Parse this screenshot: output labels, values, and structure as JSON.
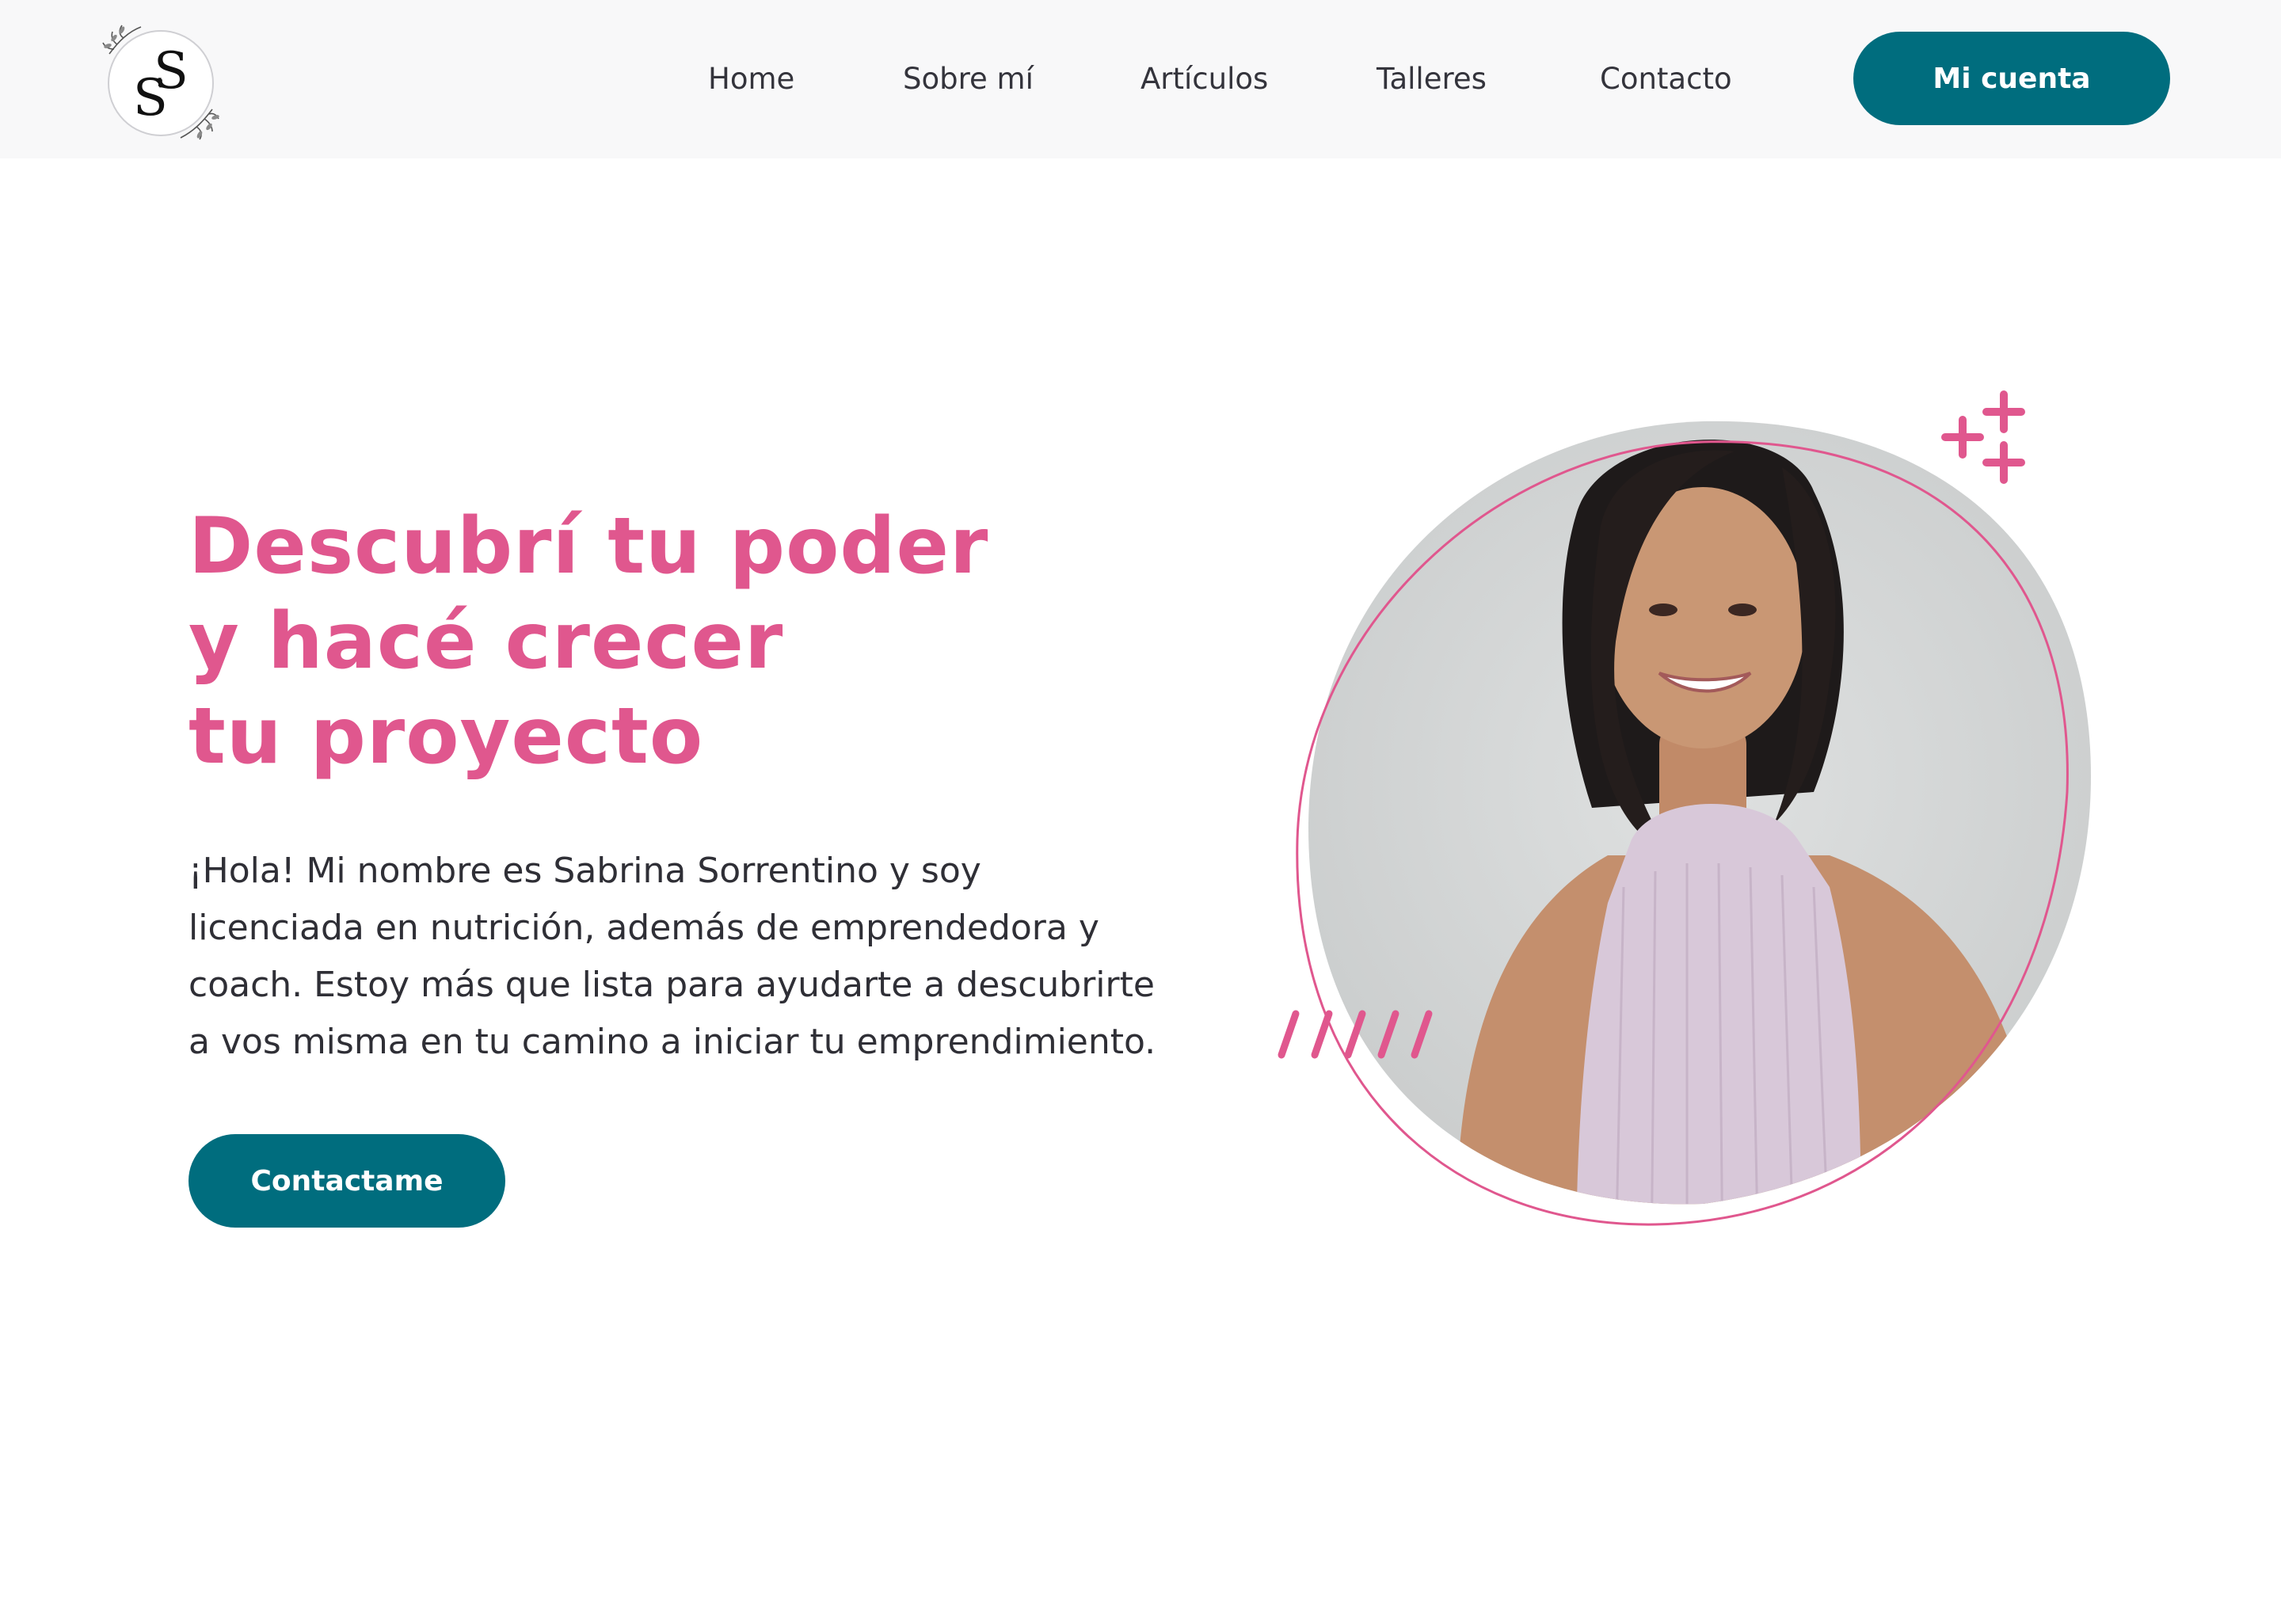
{
  "brand": {
    "logo_alt": "SS",
    "logo_letters": [
      "S",
      "S"
    ],
    "colors": {
      "pink": "#e0578e",
      "teal": "#006d7e",
      "header_bg": "#f8f8f9",
      "text": "#2f2f36"
    }
  },
  "nav": {
    "items": [
      {
        "label": "Home"
      },
      {
        "label": "Sobre mí"
      },
      {
        "label": "Artículos"
      },
      {
        "label": "Talleres"
      },
      {
        "label": "Contacto"
      }
    ],
    "account_button": "Mi cuenta"
  },
  "hero": {
    "title_lines": [
      "Descubrí tu poder",
      "y hacé crecer",
      "tu proyecto"
    ],
    "intro_lines": [
      "¡Hola! Mi nombre es Sabrina Sorrentino y soy",
      "licenciada en nutrición, además de emprendedora y",
      "coach. Estoy más que lista para ayudarte a descubrirte",
      "a vos misma en tu camino a iniciar tu emprendimiento."
    ],
    "cta_button": "Contactame"
  },
  "icons": {
    "logo": "monogram-logo-icon",
    "plus_decoration": "plus-signs-icon",
    "slash_decoration": "slash-lines-icon"
  }
}
